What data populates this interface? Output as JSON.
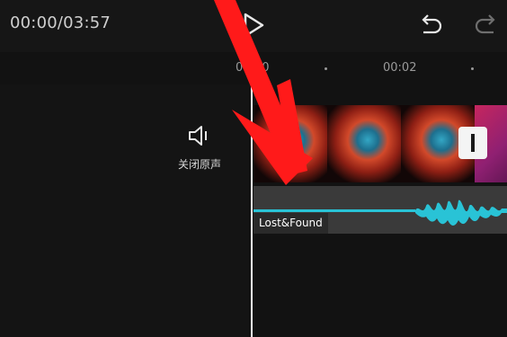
{
  "toolbar": {
    "timecode": "00:00/03:57",
    "play_icon": "play-icon",
    "undo_icon": "undo-icon",
    "redo_icon": "redo-icon"
  },
  "ruler": {
    "ticks": [
      "00:00",
      "00:02"
    ]
  },
  "audio_control": {
    "icon": "speaker-icon",
    "label": "关闭原声"
  },
  "timeline": {
    "audio_clip_name": "Lost&Found"
  },
  "overlay": {
    "annotation": "red-arrow",
    "color": "#ff1a1a"
  }
}
